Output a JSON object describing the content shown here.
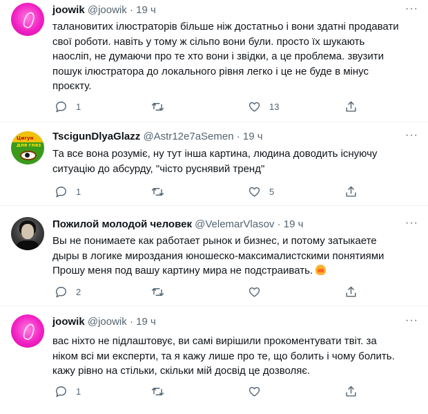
{
  "tweets": [
    {
      "name": "joowik",
      "handle": "@joowik",
      "time": "19 ч",
      "avatar": "pink-abstract-avatar",
      "lines": [
        "талановитих ілюстраторів більше ніж достатньо і вони здатні продавати",
        "свої роботи. навіть у тому ж сільпо вони були. просто їх шукають",
        "наосліп, не думаючи про те хто вони і звідки, а це проблема. звузити",
        "пошук ілюстратора до локального рівня легко і це не буде в мінус",
        "проєкту."
      ],
      "replies": "1",
      "retweets": "",
      "likes": "13"
    },
    {
      "name": "TscigunDlyaGlazz",
      "handle": "@Astr12e7aSemen",
      "time": "19 ч",
      "avatar": "book-cover-avatar",
      "avatar_text": [
        "Цигун",
        "для глаз"
      ],
      "lines": [
        "Та все вона розуміє, ну тут інша картина, людина доводить існуючу",
        "ситуацію до абсурду, \"чісто руснявий тренд\""
      ],
      "replies": "1",
      "retweets": "",
      "likes": "5"
    },
    {
      "name": "Пожилой молодой человек",
      "handle": "@VelemarVlasov",
      "time": "19 ч",
      "avatar": "dark-portrait-avatar",
      "lines": [
        "Вы не понимаете как работает рынок и бизнес, и потому затыкаете",
        "дыры в логике мироздания юношеско-максималистскими понятиями",
        "Прошу меня под вашу картину мира не подстраивать."
      ],
      "emoji": "person-gesturing-emoji",
      "replies": "2",
      "retweets": "",
      "likes": ""
    },
    {
      "name": "joowik",
      "handle": "@joowik",
      "time": "19 ч",
      "avatar": "pink-abstract-avatar",
      "lines": [
        "вас ніхто не підлаштовує, ви самі вирішили прокоментувати твіт. за",
        "ніком всі ми експерти, та я кажу лише про те, що болить і чому болить.",
        "кажу рівно на стільки, скільки мій досвід це дозволяє."
      ],
      "replies": "1",
      "retweets": "",
      "likes": ""
    }
  ],
  "ui": {
    "separator": "·",
    "more": "···"
  }
}
